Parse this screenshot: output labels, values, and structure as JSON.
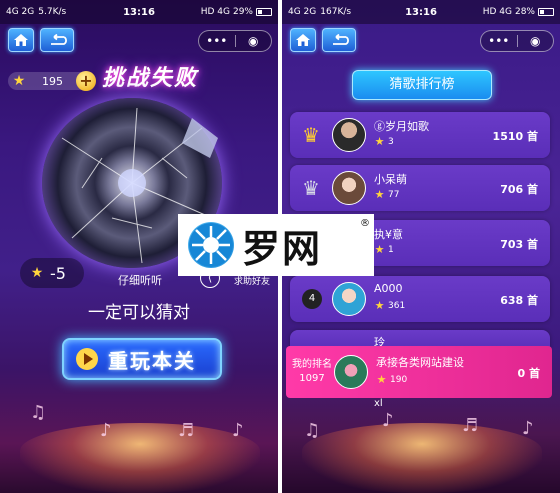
{
  "left": {
    "status": {
      "network": "4G  2G",
      "speed": "5.7K/s",
      "time": "13:16",
      "signal": "HD 4G",
      "battery": "29%"
    },
    "coins": "195",
    "fail_title": "挑战失败",
    "penalty": "-5",
    "hint_label": "仔细听听",
    "help_label": "求助好友",
    "encourage": "一定可以猜对",
    "replay_label": "重玩本关"
  },
  "right": {
    "status": {
      "network": "4G  2G",
      "speed": "167K/s",
      "time": "13:16",
      "signal": "HD 4G",
      "battery": "28%"
    },
    "title": "猜歌排行榜",
    "rows": [
      {
        "rank": "1",
        "name": "ⓖ岁月如歌",
        "stars": "3",
        "score": "1510 首"
      },
      {
        "rank": "2",
        "name": "小呆萌",
        "stars": "77",
        "score": "706 首"
      },
      {
        "rank": "3",
        "name": "执¥意",
        "stars": "1",
        "score": "703 首"
      },
      {
        "rank": "4",
        "name": "A000",
        "stars": "361",
        "score": "638 首"
      }
    ],
    "partial_row_name": "玲",
    "my": {
      "label": "我的排名",
      "rank": "1097",
      "name": "承接各类网站建设",
      "stars": "190",
      "score": "0 首"
    },
    "below_text": "xl"
  },
  "watermark": {
    "text": "罗网",
    "reg": "®"
  },
  "colors": {
    "accent": "#2ec6ff",
    "pink": "#ff3aa8",
    "gold": "#ffd53d"
  }
}
